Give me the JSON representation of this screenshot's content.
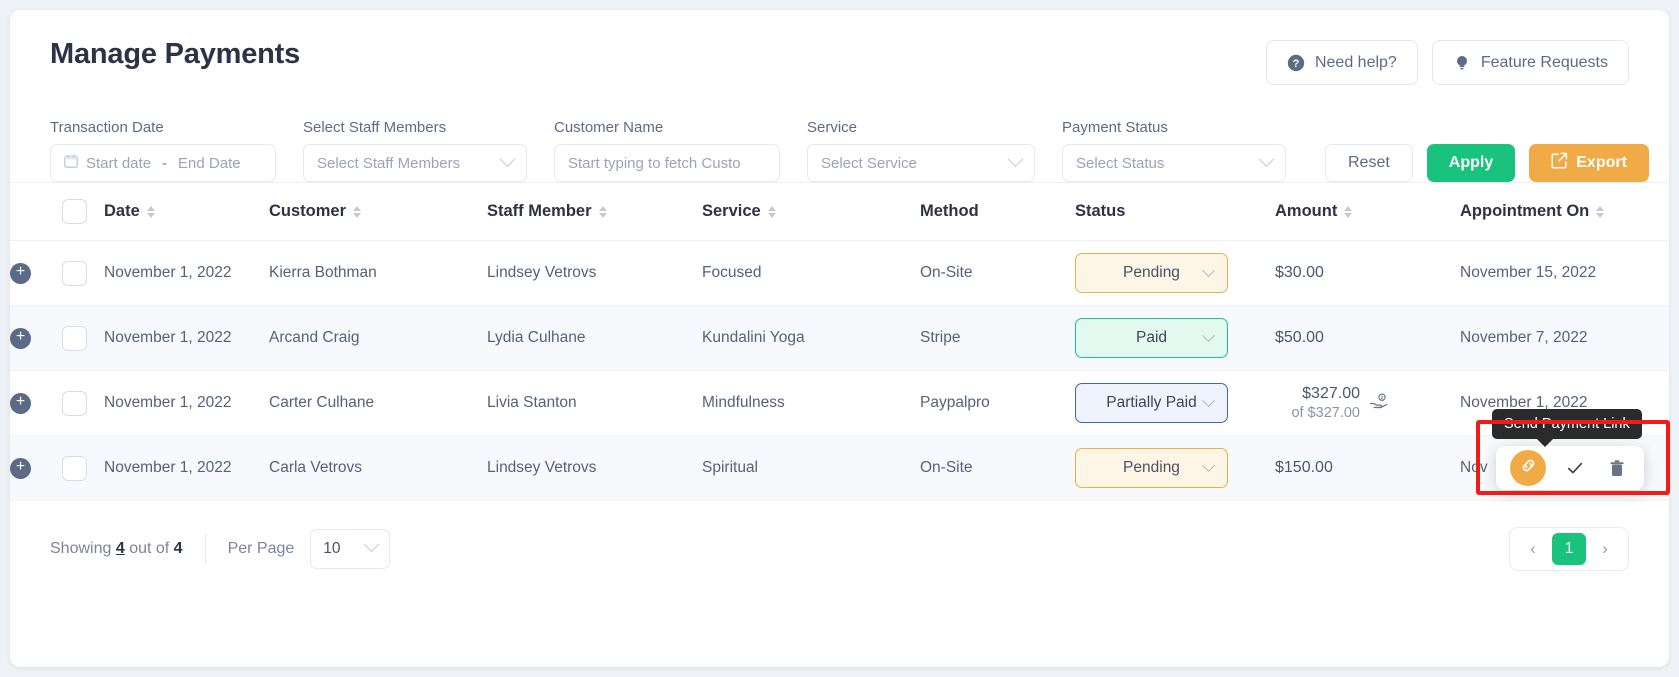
{
  "header": {
    "title": "Manage Payments",
    "need_help": "Need help?",
    "feature_requests": "Feature Requests"
  },
  "filters": {
    "transaction_date_label": "Transaction Date",
    "start_date_placeholder": "Start date",
    "date_separator": "-",
    "end_date_placeholder": "End Date",
    "staff_label": "Select Staff Members",
    "staff_placeholder": "Select Staff Members",
    "customer_label": "Customer Name",
    "customer_placeholder": "Start typing to fetch Custo",
    "service_label": "Service",
    "service_placeholder": "Select Service",
    "status_label": "Payment Status",
    "status_placeholder": "Select Status",
    "reset_label": "Reset",
    "apply_label": "Apply",
    "export_label": "Export"
  },
  "table": {
    "columns": [
      {
        "label": "Date",
        "sortable": true
      },
      {
        "label": "Customer",
        "sortable": true
      },
      {
        "label": "Staff Member",
        "sortable": true
      },
      {
        "label": "Service",
        "sortable": true
      },
      {
        "label": "Method",
        "sortable": false
      },
      {
        "label": "Status",
        "sortable": false
      },
      {
        "label": "Amount",
        "sortable": true
      },
      {
        "label": "Appointment On",
        "sortable": true
      }
    ],
    "rows": [
      {
        "date": "November 1, 2022",
        "customer": "Kierra Bothman",
        "staff": "Lindsey Vetrovs",
        "service": "Focused",
        "method": "On-Site",
        "status": "Pending",
        "status_kind": "pending",
        "amount": "$30.00",
        "amount_sub": "",
        "appointment_on": "November 15, 2022"
      },
      {
        "date": "November 1, 2022",
        "customer": "Arcand Craig",
        "staff": "Lydia Culhane",
        "service": "Kundalini Yoga",
        "method": "Stripe",
        "status": "Paid",
        "status_kind": "paid",
        "amount": "$50.00",
        "amount_sub": "",
        "appointment_on": "November 7, 2022"
      },
      {
        "date": "November 1, 2022",
        "customer": "Carter Culhane",
        "staff": "Livia Stanton",
        "service": "Mindfulness",
        "method": "Paypalpro",
        "status": "Partially Paid",
        "status_kind": "partial",
        "amount": "$327.00",
        "amount_sub": "of $327.00",
        "appointment_on": "November 1, 2022"
      },
      {
        "date": "November 1, 2022",
        "customer": "Carla Vetrovs",
        "staff": "Lindsey Vetrovs",
        "service": "Spiritual",
        "method": "On-Site",
        "status": "Pending",
        "status_kind": "pending",
        "amount": "$150.00",
        "amount_sub": "",
        "appointment_on": "Nov"
      }
    ]
  },
  "popup": {
    "tooltip": "Send Payment Link"
  },
  "footer": {
    "showing_prefix": "Showing",
    "showing_count": "4",
    "showing_mid": "out of",
    "showing_total": "4",
    "per_page_label": "Per Page",
    "per_page_value": "10",
    "prev": "‹",
    "page": "1",
    "next": "›"
  },
  "colors": {
    "accent_green": "#19c37d",
    "accent_orange": "#f0ab46",
    "pending_border": "#e9ae4e",
    "paid_border": "#18c88b",
    "partial_border": "#3b64cf",
    "annotation_red": "#ef1d16"
  }
}
